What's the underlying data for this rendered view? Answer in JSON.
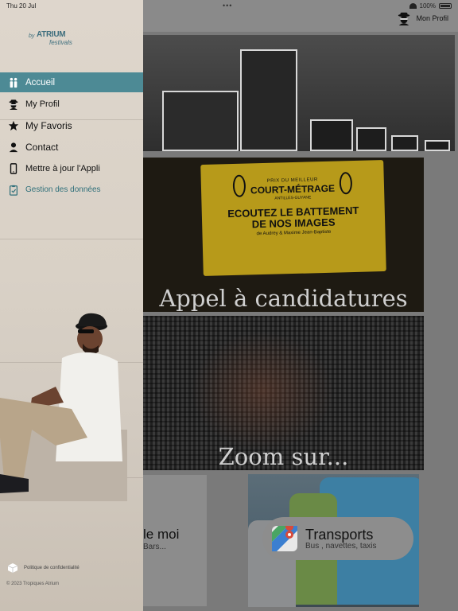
{
  "status_bar": {
    "time_day": "Thu 20 Jul",
    "battery": "100%"
  },
  "header": {
    "profile_label": "Mon Profil",
    "profile_icon": "spy-avatar-icon"
  },
  "drawer": {
    "logo": {
      "prefix": "by",
      "brand": "ATRIUM",
      "sub": "festivals"
    },
    "items": [
      {
        "label": "Accueil",
        "icon": "people-icon",
        "active": true
      },
      {
        "label": "My Profil",
        "icon": "spy-avatar-icon",
        "active": false
      },
      {
        "label": "My Favoris",
        "icon": "star-icon",
        "active": false
      },
      {
        "label": "Contact",
        "icon": "person-icon",
        "active": false
      },
      {
        "label": "Mettre à jour l'Appli",
        "icon": "phone-icon",
        "active": false
      },
      {
        "label": "Gestion des données",
        "icon": "clipboard-check-icon",
        "active": false
      }
    ],
    "policy_label": "Politique de confidentialité",
    "copyright": "© 2023 Tropiques Atrium"
  },
  "cards": {
    "poster": {
      "line1": "PRIX DU MEILLEUR",
      "line2": "COURT-MÉTRAGE",
      "line3": "ANTILLES-GUYANE",
      "line4a": "ECOUTEZ LE BATTEMENT",
      "line4b": "DE NOS IMAGES",
      "line5": "de Audrey & Maxime Jean-Baptiste"
    },
    "appel": {
      "title": "Appel à candidatures"
    },
    "zoom": {
      "title": "Zoom sur..."
    },
    "bars": {
      "title": "le moi",
      "subtitle": "Bars..."
    },
    "transports": {
      "title": "Transports",
      "subtitle": "Bus , navettes, taxis"
    }
  },
  "colors": {
    "accent": "#4d8a95",
    "drawer_bg": "#dcd4ca",
    "overlay": "#7a7a7a"
  }
}
